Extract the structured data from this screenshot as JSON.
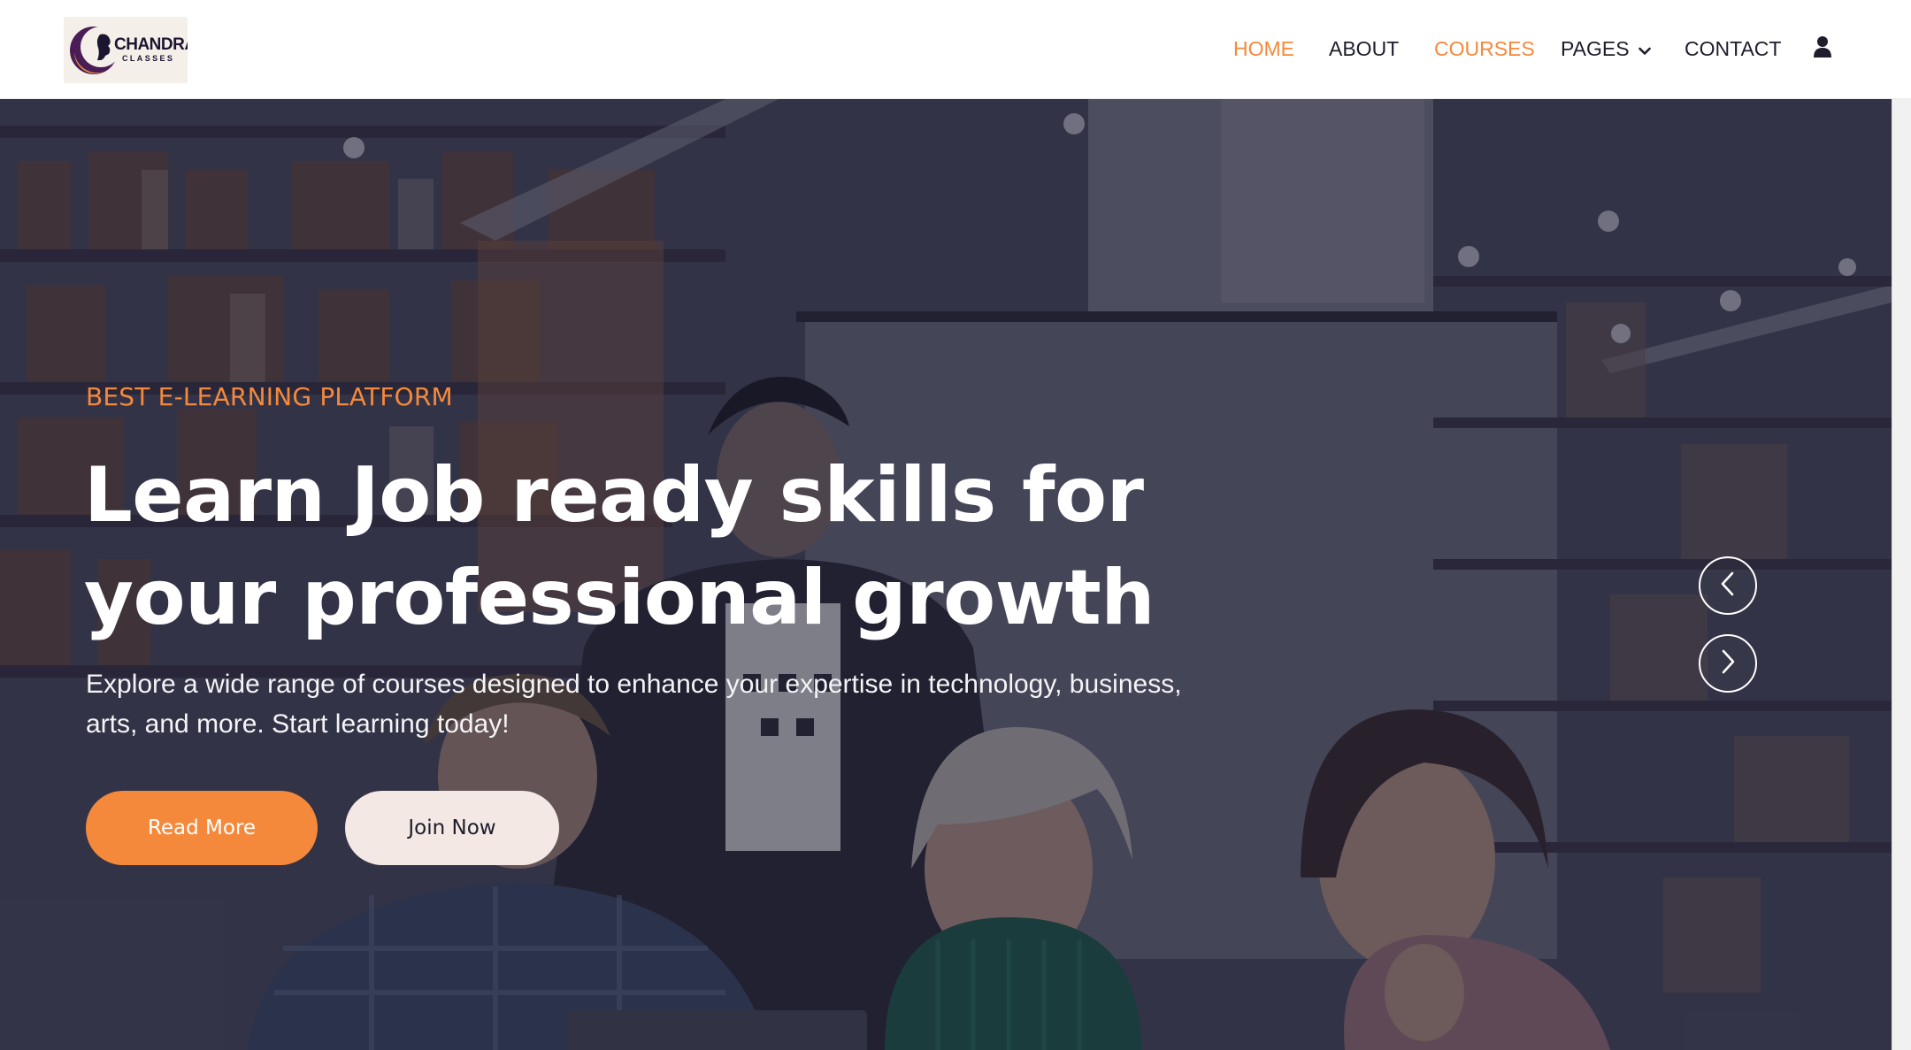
{
  "brand": {
    "name": "CHANDRA",
    "tagline": "CLASSES",
    "accent_color": "#f5893b",
    "dark_color": "#1d1d2c"
  },
  "nav": {
    "items": [
      {
        "label": "HOME",
        "active": true
      },
      {
        "label": "ABOUT",
        "active": false
      },
      {
        "label": "COURSES",
        "active": true
      },
      {
        "label": "PAGES",
        "active": false,
        "has_dropdown": true
      },
      {
        "label": "CONTACT",
        "active": false
      }
    ],
    "user_icon": "user-icon"
  },
  "hero": {
    "eyebrow": "BEST E-LEARNING PLATFORM",
    "headline_line1": "Learn Job ready skills for",
    "headline_line2": "your professional growth",
    "description": "Explore a wide range of courses designed to enhance your expertise in technology, business, arts, and more. Start learning today!",
    "primary_button": "Read More",
    "secondary_button": "Join Now",
    "prev_icon": "chevron-left-icon",
    "next_icon": "chevron-right-icon"
  }
}
